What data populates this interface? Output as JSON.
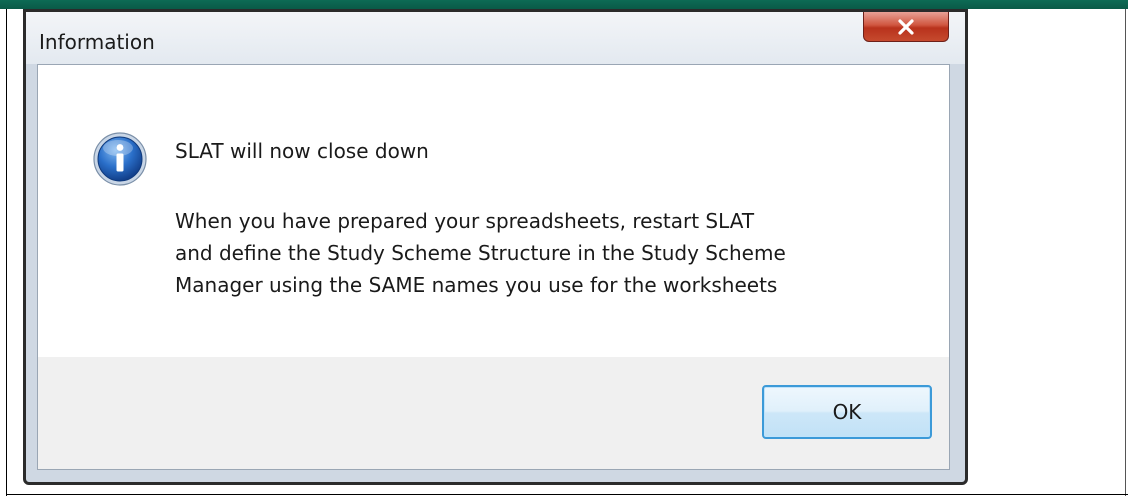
{
  "dialog": {
    "title": "Information",
    "close_icon": "close-icon",
    "icon": "information-icon",
    "message_title": "SLAT will now close down",
    "message_lines": [
      "When you have prepared your spreadsheets, restart SLAT",
      "and define the Study Scheme Structure in the Study Scheme",
      "Manager using the SAME names you use for the worksheets"
    ],
    "ok_label": "OK"
  },
  "colors": {
    "accent_strip": "#0d6b55",
    "close_button": "#c64a2e",
    "ok_button_border": "#3c9ad8",
    "info_icon": "#1f5fb8"
  }
}
